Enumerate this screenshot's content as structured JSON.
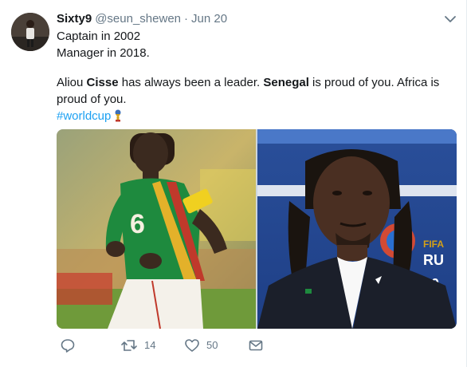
{
  "tweet": {
    "author": {
      "name": "Sixty9",
      "handle": "@seun_shewen"
    },
    "separator": "·",
    "timestamp": "Jun 20",
    "text": {
      "line1": "Captain in 2002",
      "line2": "Manager in 2018.",
      "p2_before_cisse": "Aliou ",
      "cisse": "Cisse",
      "p2_mid": " has always been a leader. ",
      "senegal": "Senegal",
      "p2_after": " is proud of you. Africa is proud of you.",
      "hashtag": "#worldcup"
    },
    "media": {
      "left_image": "player-in-green-jersey-photo",
      "right_image": "manager-in-suit-photo"
    },
    "actions": {
      "reply_count": "",
      "retweet_count": "14",
      "like_count": "50"
    },
    "colors": {
      "accent": "#1da1f2",
      "secondary_text": "#657786",
      "jersey_green": "#1e8a3e"
    }
  }
}
